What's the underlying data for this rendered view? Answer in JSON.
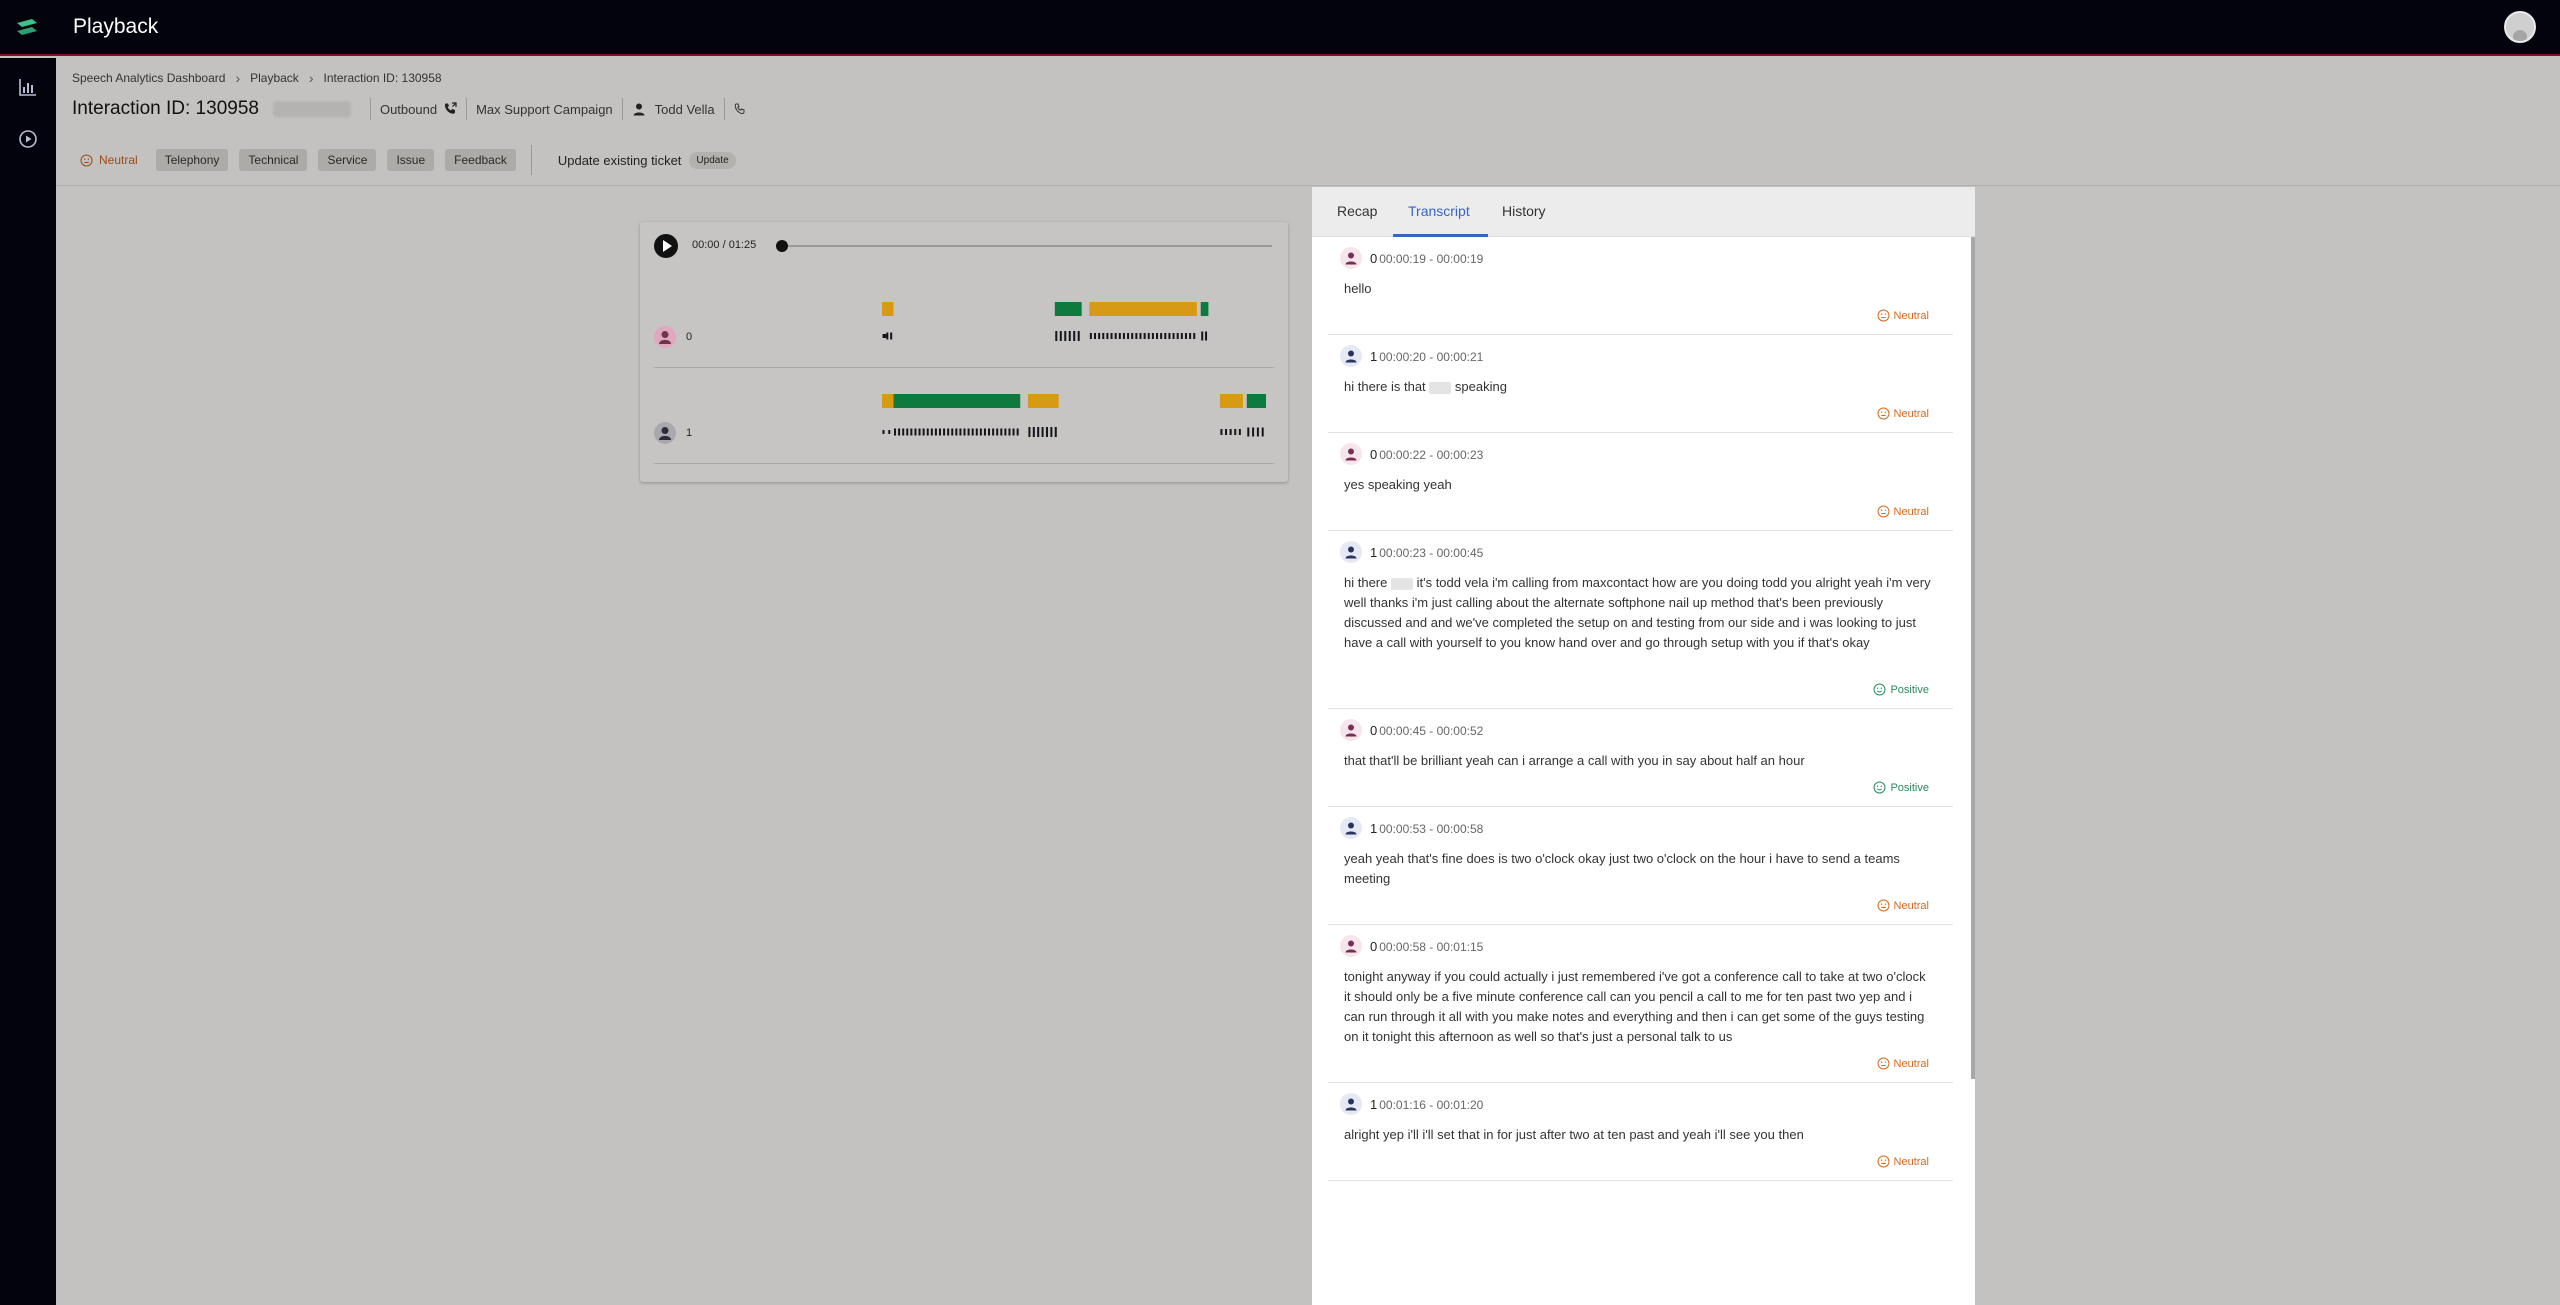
{
  "app": {
    "title": "Playback"
  },
  "colors": {
    "topbar": "#03030d",
    "accent": "#3b63c7",
    "positive_lane": "#0d7a3e",
    "neutral_lane": "#d79a14",
    "neutral_text": "#d46a1c",
    "positive_text": "#2a8a5f"
  },
  "sidebar": {
    "items": [
      {
        "icon": "bar-chart-icon"
      },
      {
        "icon": "play-circle-icon"
      }
    ]
  },
  "breadcrumb": {
    "items": [
      "Speech Analytics Dashboard",
      "Playback",
      "Interaction ID: 130958"
    ]
  },
  "header": {
    "title": "Interaction ID: 130958",
    "direction": "Outbound",
    "campaign": "Max Support Campaign",
    "agent": "Todd Vella"
  },
  "tags": {
    "sentiment": "Neutral",
    "chips": [
      "Telephony",
      "Technical",
      "Service",
      "Issue",
      "Feedback"
    ],
    "ticket_label": "Update existing ticket",
    "update_button": "Update"
  },
  "player": {
    "time": "00:00 / 01:25",
    "progress": 0,
    "speakers": [
      {
        "label": "0",
        "segments": [
          {
            "start": 0.0,
            "end": 0.01,
            "sentiment": "neutral"
          },
          {
            "start": 0.01,
            "end": 0.03,
            "sentiment": "neutral"
          },
          {
            "start": 0.45,
            "end": 0.52,
            "sentiment": "positive"
          },
          {
            "start": 0.54,
            "end": 0.82,
            "sentiment": "neutral"
          },
          {
            "start": 0.83,
            "end": 0.85,
            "sentiment": "positive"
          }
        ]
      },
      {
        "label": "1",
        "segments": [
          {
            "start": 0.0,
            "end": 0.03,
            "sentiment": "neutral"
          },
          {
            "start": 0.03,
            "end": 0.36,
            "sentiment": "positive"
          },
          {
            "start": 0.38,
            "end": 0.46,
            "sentiment": "neutral"
          },
          {
            "start": 0.88,
            "end": 0.94,
            "sentiment": "neutral"
          },
          {
            "start": 0.95,
            "end": 1.0,
            "sentiment": "positive"
          }
        ]
      }
    ]
  },
  "tabs": [
    "Recap",
    "Transcript",
    "History"
  ],
  "transcript": [
    {
      "speaker": "0",
      "time": "00:00:19 - 00:00:19",
      "text": "hello",
      "sentiment": "Neutral"
    },
    {
      "speaker": "1",
      "time": "00:00:20 - 00:00:21",
      "text": "hi there is that [redacted] speaking",
      "sentiment": "Neutral"
    },
    {
      "speaker": "0",
      "time": "00:00:22 - 00:00:23",
      "text": "yes speaking yeah",
      "sentiment": "Neutral"
    },
    {
      "speaker": "1",
      "time": "00:00:23 - 00:00:45",
      "text": "hi there [redacted] it's todd vela i'm calling from maxcontact how are you doing todd you alright yeah i'm very well thanks i'm just calling about the alternate softphone nail up method that's been previously discussed and and we've completed the setup on and testing from our side and i was looking to just have a call with yourself to you know hand over and go through setup with you if that's okay",
      "sentiment": "Positive"
    },
    {
      "speaker": "0",
      "time": "00:00:45 - 00:00:52",
      "text": "that that'll be brilliant yeah can i arrange a call with you in say about half an hour",
      "sentiment": "Positive"
    },
    {
      "speaker": "1",
      "time": "00:00:53 - 00:00:58",
      "text": "yeah yeah that's fine does is two o'clock okay just two o'clock on the hour i have to send a teams meeting",
      "sentiment": "Neutral"
    },
    {
      "speaker": "0",
      "time": "00:00:58 - 00:01:15",
      "text": "tonight anyway if you could actually i just remembered i've got a conference call to take at two o'clock it should only be a five minute conference call can you pencil a call to me for ten past two yep and i can run through it all with you make notes and everything and then i can get some of the guys testing on it tonight this afternoon as well so that's just a personal talk to us",
      "sentiment": "Neutral"
    },
    {
      "speaker": "1",
      "time": "00:01:16 - 00:01:20",
      "text": "alright yep i'll i'll set that in for just after two at ten past and yeah i'll see you then",
      "sentiment": "Neutral"
    }
  ]
}
